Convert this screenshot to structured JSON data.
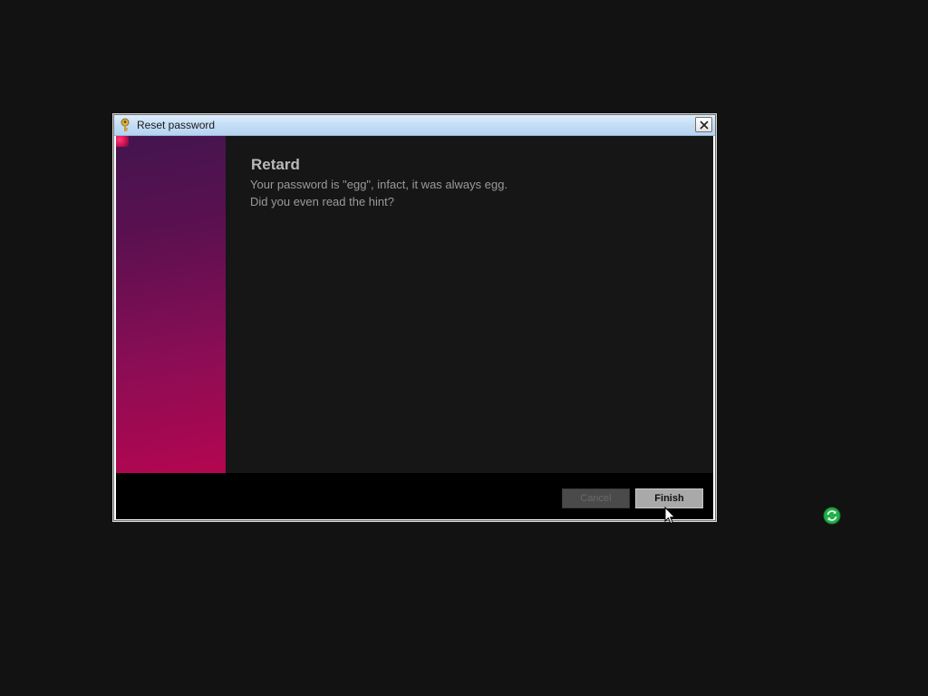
{
  "dialog": {
    "title": "Reset password",
    "icon": "key-icon",
    "close_icon": "close-icon"
  },
  "content": {
    "heading": "Retard",
    "line1": "Your password is \"egg\", infact, it was always egg.",
    "line2": "Did you even read the hint?"
  },
  "buttons": {
    "cancel_label": "Cancel",
    "finish_label": "Finish"
  },
  "desktop": {
    "tray_icon": "refresh-icon",
    "cursor": "mouse-cursor-icon"
  },
  "colors": {
    "desktop_bg": "#121212",
    "content_bg": "#161616",
    "accent_band_top": "#43154f",
    "accent_band_bottom": "#b40650",
    "tray_icon_green": "#22b04a"
  }
}
